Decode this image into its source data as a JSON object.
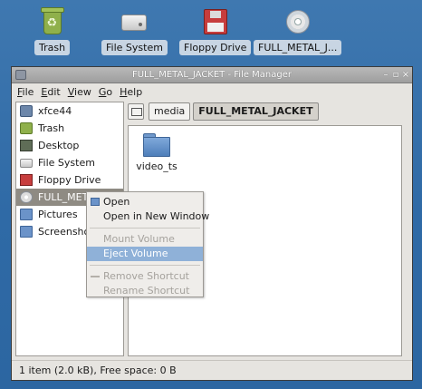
{
  "desktop": {
    "icons": [
      {
        "label": "Trash",
        "icon": "trash-icon"
      },
      {
        "label": "File System",
        "icon": "hard-drive-icon"
      },
      {
        "label": "Floppy Drive",
        "icon": "floppy-icon"
      },
      {
        "label": "FULL_METAL_J...",
        "icon": "disc-icon"
      }
    ]
  },
  "window": {
    "title": "FULL_METAL_JACKET - File Manager",
    "controls": {
      "minimize": "–",
      "maximize": "▫",
      "close": "×"
    },
    "menubar": [
      {
        "mnemonic": "F",
        "rest": "ile"
      },
      {
        "mnemonic": "E",
        "rest": "dit"
      },
      {
        "mnemonic": "V",
        "rest": "iew"
      },
      {
        "mnemonic": "G",
        "rest": "o"
      },
      {
        "mnemonic": "H",
        "rest": "elp"
      }
    ],
    "sidebar": {
      "items": [
        {
          "label": "xfce44",
          "icon": "home-folder-icon"
        },
        {
          "label": "Trash",
          "icon": "trash-icon"
        },
        {
          "label": "Desktop",
          "icon": "desktop-icon"
        },
        {
          "label": "File System",
          "icon": "hard-drive-icon"
        },
        {
          "label": "Floppy Drive",
          "icon": "floppy-icon"
        },
        {
          "label": "FULL_METAL_JACKET",
          "icon": "disc-icon",
          "selected": true
        },
        {
          "label": "Pictures",
          "icon": "folder-icon"
        },
        {
          "label": "Screenshots",
          "icon": "folder-icon"
        }
      ]
    },
    "pathbar": {
      "crumbs": [
        {
          "label": "media"
        },
        {
          "label": "FULL_METAL_JACKET",
          "active": true
        }
      ]
    },
    "content": {
      "files": [
        {
          "name": "video_ts",
          "icon": "folder-icon"
        }
      ]
    },
    "status": "1 item (2.0 kB), Free space: 0 B"
  },
  "context_menu": {
    "items": [
      {
        "label": "Open",
        "icon": "folder-icon",
        "enabled": true
      },
      {
        "label": "Open in New Window",
        "enabled": true
      },
      {
        "separator": true
      },
      {
        "label": "Mount Volume",
        "enabled": false
      },
      {
        "label": "Eject Volume",
        "enabled": true,
        "highlighted": true
      },
      {
        "separator": true
      },
      {
        "label": "Remove Shortcut",
        "icon": "remove-icon",
        "enabled": false
      },
      {
        "label": "Rename Shortcut",
        "enabled": false
      }
    ]
  }
}
